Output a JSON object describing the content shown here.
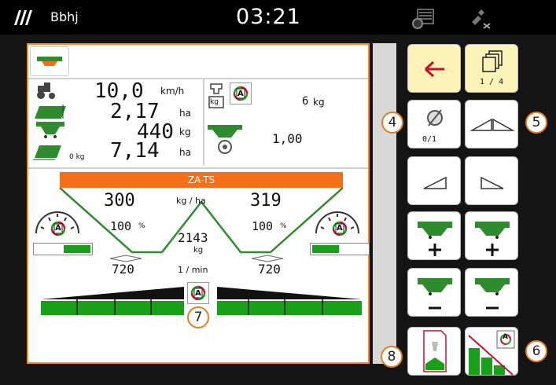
{
  "topbar": {
    "profile_name": "Bbhj",
    "clock": "03:21"
  },
  "work_data": {
    "speed_value": "10,0",
    "speed_unit": "km/h",
    "area1_value": "2,17",
    "area1_unit": "ha",
    "mass_value": "440",
    "mass_unit": "kg",
    "area2_value": "7,14",
    "area2_unit": "ha",
    "zero_kg": "0 kg",
    "weigh_value": "6",
    "weigh_unit": "kg",
    "factor_value": "1,00",
    "kg_label": "kg"
  },
  "spreader": {
    "title": "ZA-TS",
    "rate_left": "300",
    "rate_unit": "kg / ha",
    "rate_right": "319",
    "pct_left": "100",
    "pct_unit": "%",
    "pct_right": "100",
    "total_value": "2143",
    "total_unit": "kg",
    "rpm_left": "720",
    "rpm_unit": "1 / min",
    "rpm_right": "720",
    "auto_label": "A"
  },
  "right_buttons": {
    "page_indicator": "1 / 4",
    "counter": "0/1"
  },
  "callouts": {
    "c4": "4",
    "c5": "5",
    "c6": "6",
    "c7": "7",
    "c8": "8"
  },
  "colors": {
    "accent_orange": "#ff8c1a",
    "title_bar": "#f36f1a",
    "spreader_green": "#2e8b2e",
    "bright_green": "#19a019",
    "soft_yellow": "#fbf3b8",
    "arrow_red": "#c8102e"
  }
}
